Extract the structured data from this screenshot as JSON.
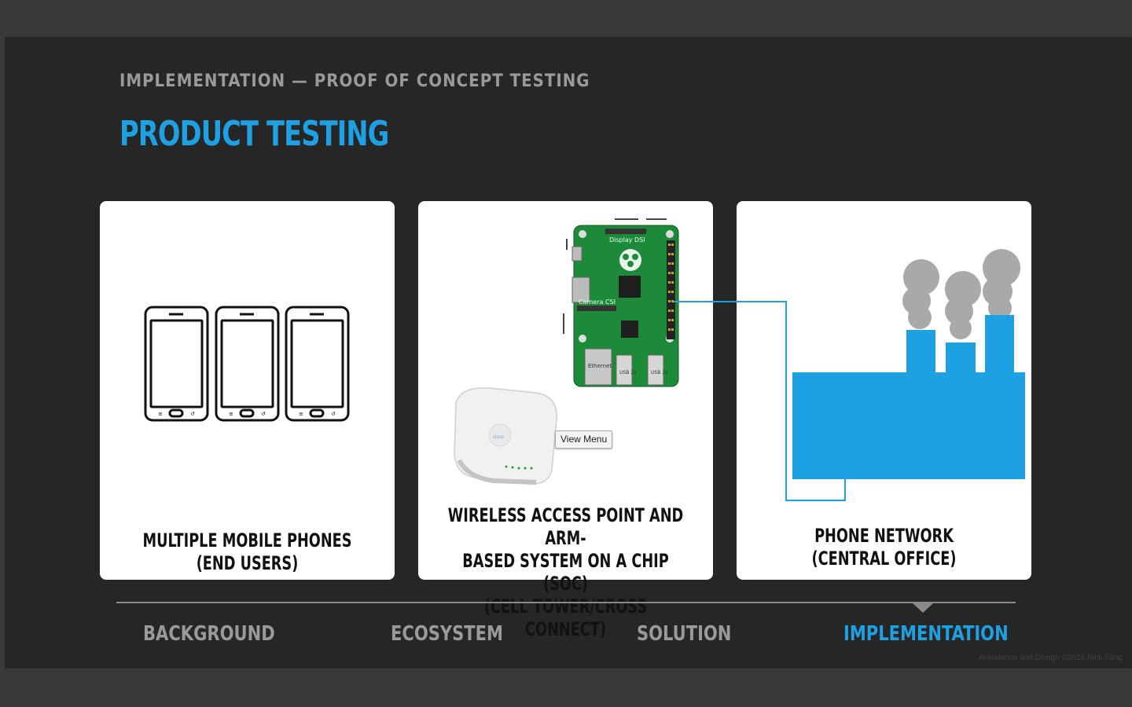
{
  "slide": {
    "kicker": "IMPLEMENTATION — PROOF OF CONCEPT TESTING",
    "title": "PRODUCT TESTING",
    "accent_color": "#1da1e3"
  },
  "cards": [
    {
      "label": "MULTIPLE MOBILE PHONES\n(END USERS)",
      "icon": "smartphones-icon"
    },
    {
      "label": "WIRELESS ACCESS POINT AND ARM-\nBASED SYSTEM ON A CHIP (SOC)\n(CELL TOWER/CROSS CONNECT)",
      "icon": "raspberry-pi-board-icon"
    },
    {
      "label": "PHONE NETWORK\n(CENTRAL OFFICE)",
      "icon": "factory-icon"
    }
  ],
  "board": {
    "top_label": "Display DSI",
    "camera_label": "Camera CSI",
    "usb_label": "USB 2x",
    "ethernet_label": "Ethernet"
  },
  "tooltip": "View Menu",
  "nav": {
    "items": [
      "BACKGROUND",
      "ECOSYSTEM",
      "SOLUTION",
      "IMPLEMENTATION"
    ],
    "active_index": 3
  },
  "credit": "Animations and Design ©2016 Nick Fong"
}
